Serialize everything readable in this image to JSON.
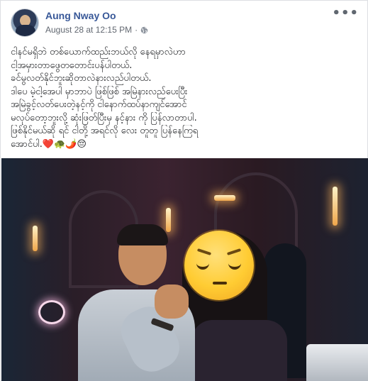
{
  "post": {
    "author": "Aung Nway Oo",
    "date": "August 28 at 12:15 PM",
    "separator": "·",
    "more_menu": "•••",
    "text_lines": [
      "ငါနင်မရှိဘဲ တစ်ယောက်ထည်းဘယ်လို နေရမှာလဲဟာ",
      "ငါ့အမှားတာဖွေတတောင်းပန်ပါတယ်.",
      "ခင်မွလတ်နိုင်ဘူးဆိုတာလဲနားလည်ပါတယ်.",
      "ဒါပေ မဲ့ငါ့အေပါ မှာဘာပဲ ဖြစ်ဖြစ် အမြဲနားလည်ပေးပြီး",
      "အမြဲခွင့်လတ်ပေးတဲ့နင့်ကို ငါနောက်ထပ်နာကျင်အောင်",
      "မလုပ်တော့ဘူးလို့ ဆုံးဖြတ်ပြီးမှ နင့်နား ကို ပြန်လာတာပါ.",
      "ဖြစ်နိုင်မယ်ဆို ရင် ငါတို့ အရင်လို လေး တူတူ ပြန်နေကြရ",
      "အောင်ပါ.❤️🐢🌶️😔"
    ],
    "photo_sticker": "pensive-face-sticker"
  }
}
